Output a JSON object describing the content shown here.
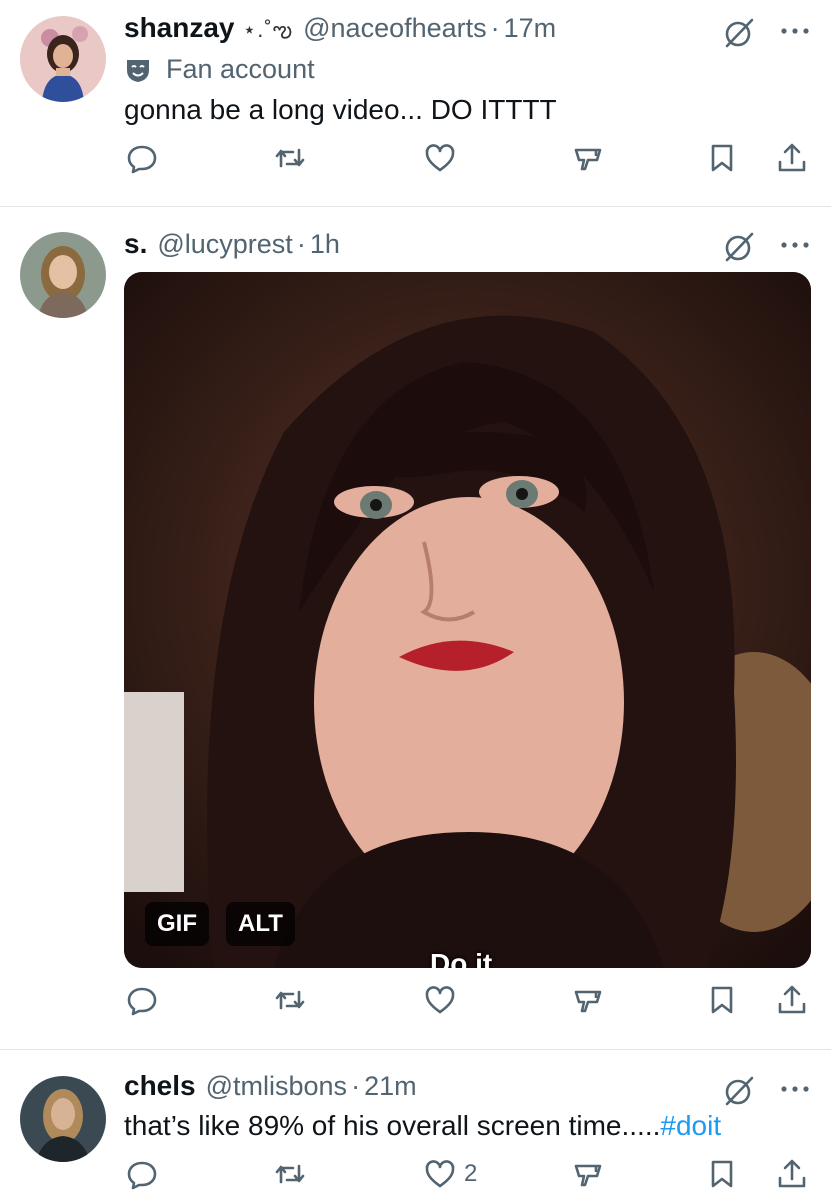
{
  "tweets": [
    {
      "name": "shanzay",
      "name_decor": "⋆.˚ఌ",
      "handle": "@naceofhearts",
      "separator": "·",
      "time": "17m",
      "label": "Fan account",
      "text": "gonna be a long video... DO ITTTT",
      "likes": ""
    },
    {
      "name": "s.",
      "handle": "@lucyprest",
      "separator": "·",
      "time": "1h",
      "media": {
        "type_badge": "GIF",
        "alt_badge": "ALT",
        "caption": "Do it"
      },
      "likes": ""
    },
    {
      "name": "chels",
      "handle": "@tmlisbons",
      "separator": "·",
      "time": "21m",
      "text": "that’s like 89% of his overall screen time.....",
      "hashtag": "#doit",
      "likes": "2"
    }
  ],
  "icons": [
    "grok-icon",
    "more-icon",
    "reply-icon",
    "retweet-icon",
    "like-icon",
    "views-icon",
    "bookmark-icon",
    "share-icon",
    "fan-mask-icon"
  ],
  "colors": {
    "text": "#0f1419",
    "secondary": "#536471",
    "link": "#1d9bf0",
    "divider": "#e1e4e8"
  }
}
